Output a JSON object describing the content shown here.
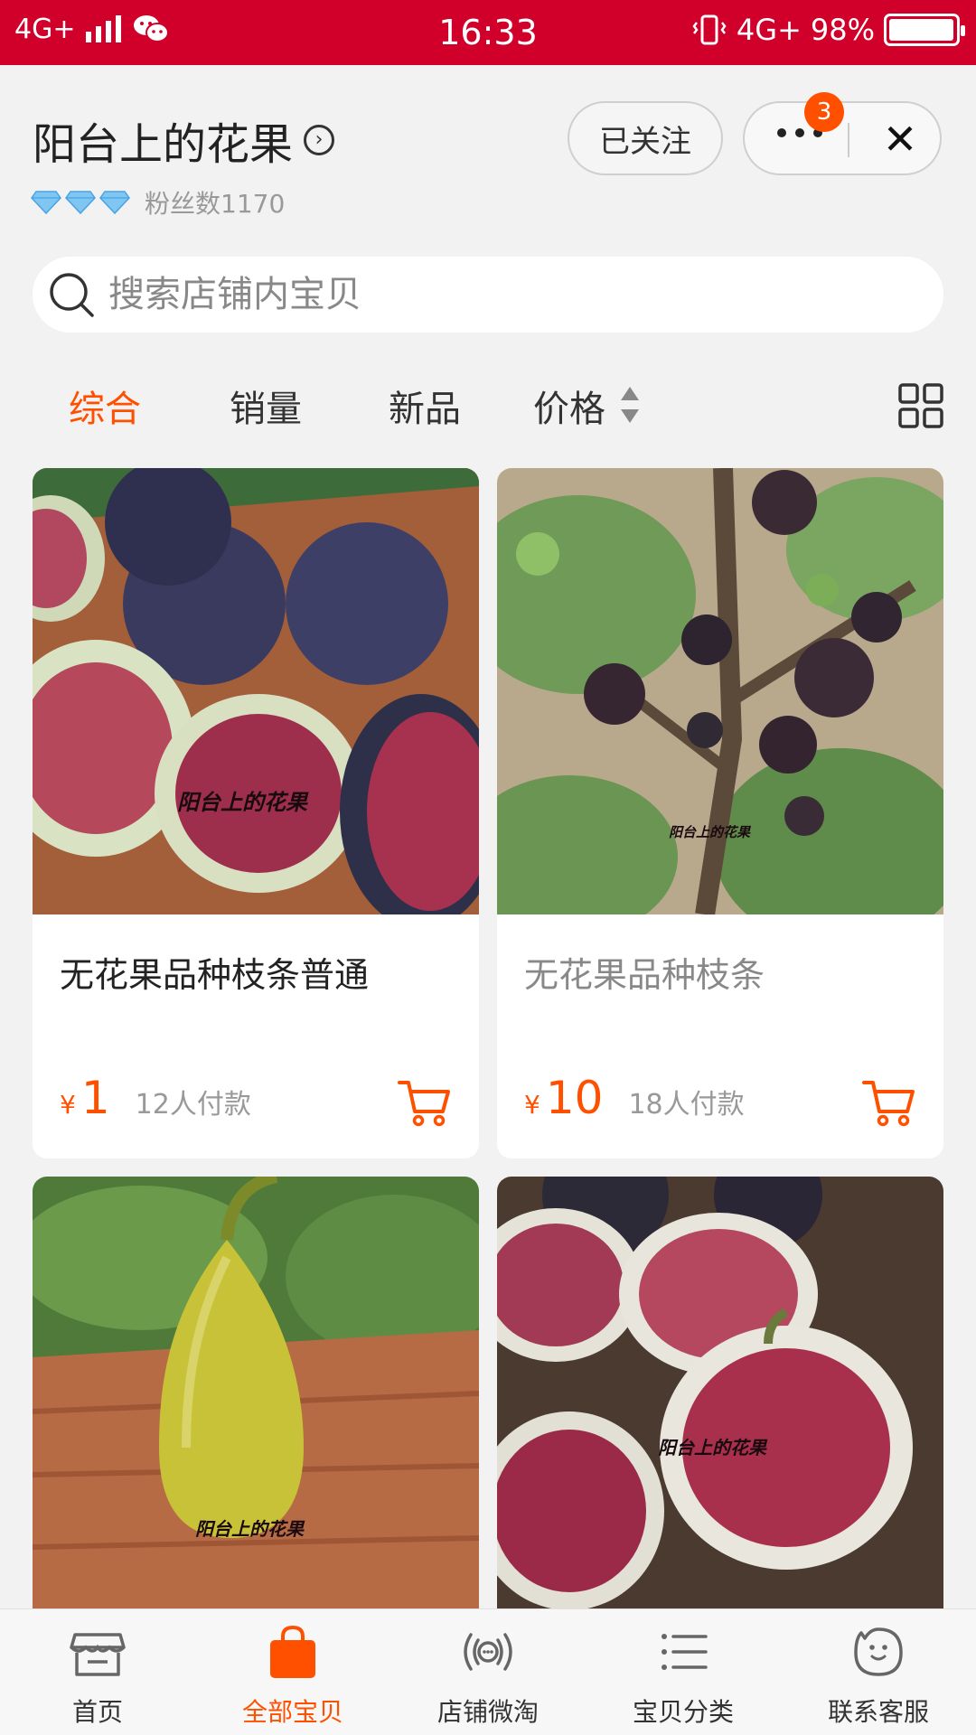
{
  "status_bar": {
    "network": "4G+",
    "time": "16:33",
    "network_right": "4G+",
    "battery_text": "98%",
    "battery_level": 0.98
  },
  "shop": {
    "name": "阳台上的花果",
    "fans": "粉丝数1170",
    "follow_label": "已关注",
    "badge_count": "3"
  },
  "search": {
    "placeholder": "搜索店铺内宝贝"
  },
  "sort_tabs": [
    {
      "label": "综合",
      "active": true
    },
    {
      "label": "销量",
      "active": false
    },
    {
      "label": "新品",
      "active": false
    },
    {
      "label": "价格",
      "active": false
    }
  ],
  "products": [
    {
      "title": "无花果品种枝条普通",
      "currency": "¥",
      "price": "1",
      "sold": "12人付款",
      "watermark": "阳台上的花果"
    },
    {
      "title": "无花果品种枝条",
      "currency": "¥",
      "price": "10",
      "sold": "18人付款",
      "watermark": "阳台上的花果"
    },
    {
      "watermark": "阳台上的花果"
    },
    {
      "watermark": "阳台上的花果"
    }
  ],
  "bottom_nav": [
    {
      "label": "首页",
      "icon": "store-icon"
    },
    {
      "label": "全部宝贝",
      "icon": "shopping-bag-icon",
      "active": true
    },
    {
      "label": "店铺微淘",
      "icon": "broadcast-icon"
    },
    {
      "label": "宝贝分类",
      "icon": "list-icon"
    },
    {
      "label": "联系客服",
      "icon": "chat-face-icon"
    }
  ],
  "colors": {
    "status_bar": "#d0002a",
    "accent": "#ff5000",
    "background": "#f2f2f2"
  }
}
